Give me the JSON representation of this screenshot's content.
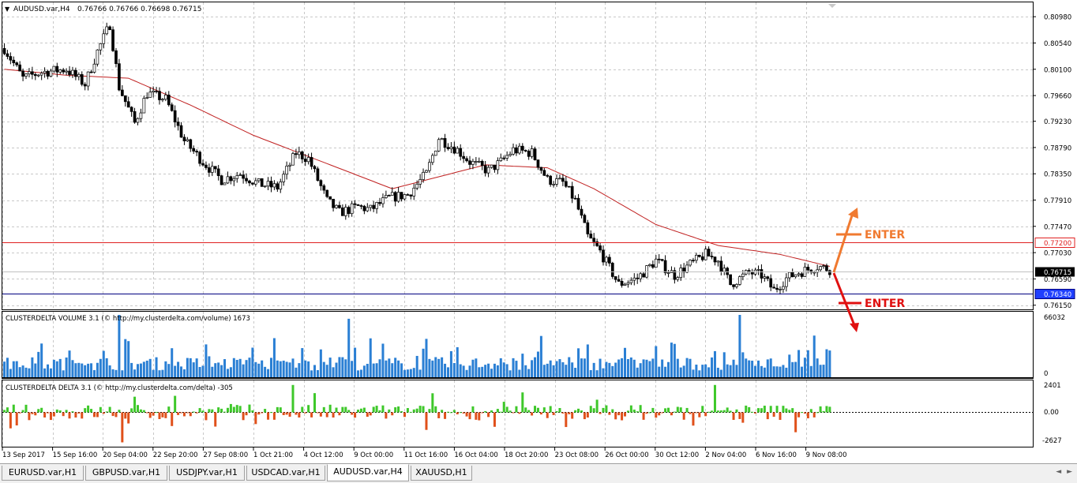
{
  "chart_header": {
    "symbol_label": "AUDUSD.var,H4",
    "ohlc": "0.76766 0.76766 0.76698 0.76715",
    "menu_arrow": "▼"
  },
  "price_axis": {
    "ticks": [
      {
        "label": "0.80980",
        "value": 0.8098
      },
      {
        "label": "0.80540",
        "value": 0.8054
      },
      {
        "label": "0.80100",
        "value": 0.801
      },
      {
        "label": "0.79660",
        "value": 0.7966
      },
      {
        "label": "0.79230",
        "value": 0.7923
      },
      {
        "label": "0.78790",
        "value": 0.7879
      },
      {
        "label": "0.78350",
        "value": 0.7835
      },
      {
        "label": "0.77910",
        "value": 0.7791
      },
      {
        "label": "0.77470",
        "value": 0.7747
      },
      {
        "label": "0.77030",
        "value": 0.7703
      },
      {
        "label": "0.76590",
        "value": 0.7659
      },
      {
        "label": "0.76150",
        "value": 0.7615
      }
    ],
    "ylim": [
      0.7608,
      0.8122
    ]
  },
  "levels": [
    {
      "label": "0.77200",
      "value": 0.772,
      "color": "#e02020",
      "label_bg": "#ffffff",
      "label_fg": "#e02020"
    },
    {
      "label": "0.76340",
      "value": 0.7634,
      "color": "#000080",
      "label_bg": "#1f3fff",
      "label_fg": "#ffffff"
    }
  ],
  "current_price": {
    "label": "0.76715",
    "value": 0.76715
  },
  "annotations": {
    "enter_up": {
      "text": "ENTER",
      "color": "#f07a30"
    },
    "enter_down": {
      "text": "ENTER",
      "color": "#e01010"
    }
  },
  "time_axis": {
    "labels": [
      "13 Sep 2017",
      "15 Sep 16:00",
      "20 Sep 04:00",
      "22 Sep 20:00",
      "27 Sep 08:00",
      "1 Oct 21:00",
      "4 Oct 12:00",
      "9 Oct 00:00",
      "11 Oct 16:00",
      "16 Oct 04:00",
      "18 Oct 20:00",
      "23 Oct 08:00",
      "26 Oct 00:00",
      "30 Oct 12:00",
      "2 Nov 04:00",
      "6 Nov 16:00",
      "9 Nov 08:00"
    ]
  },
  "volume_panel": {
    "title": "CLUSTERDELTA VOLUME 3.1 (© http://my.clusterdelta.com/volume) 1673",
    "max_label": "66032",
    "max_value": 66032,
    "zero_label": "0",
    "bar_color": "#2a7fd4"
  },
  "delta_panel": {
    "title": "CLUSTERDELTA DELTA 3.1 (© http://my.clusterdelta.com/delta) -305",
    "max_label": "2401",
    "max_value": 2401,
    "zero_label": "0.00",
    "min_label": "-2627",
    "min_value": -2627,
    "pos_color": "#3ec82a",
    "neg_color": "#e0501a"
  },
  "chart_data": {
    "type": "candlestick",
    "title": "AUDUSD.var,H4",
    "series": [
      {
        "name": "AUDUSD.var,H4",
        "anchors": [
          [
            0,
            0.8045
          ],
          [
            6,
            0.7995
          ],
          [
            12,
            0.8005
          ],
          [
            20,
            0.801
          ],
          [
            26,
            0.7985
          ],
          [
            30,
            0.804
          ],
          [
            34,
            0.8085
          ],
          [
            37,
            0.798
          ],
          [
            42,
            0.792
          ],
          [
            46,
            0.797
          ],
          [
            52,
            0.796
          ],
          [
            58,
            0.789
          ],
          [
            64,
            0.7855
          ],
          [
            70,
            0.7825
          ],
          [
            76,
            0.7835
          ],
          [
            82,
            0.7818
          ],
          [
            88,
            0.7812
          ],
          [
            94,
            0.787
          ],
          [
            98,
            0.786
          ],
          [
            104,
            0.779
          ],
          [
            108,
            0.777
          ],
          [
            114,
            0.778
          ],
          [
            118,
            0.7775
          ],
          [
            124,
            0.7795
          ],
          [
            130,
            0.78
          ],
          [
            136,
            0.7835
          ],
          [
            140,
            0.7895
          ],
          [
            146,
            0.7875
          ],
          [
            150,
            0.7855
          ],
          [
            156,
            0.784
          ],
          [
            160,
            0.7855
          ],
          [
            164,
            0.7875
          ],
          [
            170,
            0.787
          ],
          [
            175,
            0.7825
          ],
          [
            180,
            0.782
          ],
          [
            184,
            0.779
          ],
          [
            188,
            0.773
          ],
          [
            192,
            0.7705
          ],
          [
            198,
            0.765
          ],
          [
            204,
            0.766
          ],
          [
            210,
            0.769
          ],
          [
            216,
            0.7665
          ],
          [
            220,
            0.768
          ],
          [
            226,
            0.77
          ],
          [
            230,
            0.769
          ],
          [
            234,
            0.765
          ],
          [
            240,
            0.767
          ],
          [
            244,
            0.7665
          ],
          [
            248,
            0.764
          ],
          [
            252,
            0.766
          ],
          [
            256,
            0.767
          ],
          [
            262,
            0.768
          ],
          [
            266,
            0.7675
          ]
        ]
      },
      {
        "name": "MA",
        "anchors": [
          [
            0,
            0.801
          ],
          [
            20,
            0.8
          ],
          [
            40,
            0.7995
          ],
          [
            60,
            0.795
          ],
          [
            80,
            0.79
          ],
          [
            100,
            0.786
          ],
          [
            125,
            0.781
          ],
          [
            140,
            0.783
          ],
          [
            155,
            0.785
          ],
          [
            175,
            0.7845
          ],
          [
            190,
            0.781
          ],
          [
            210,
            0.775
          ],
          [
            230,
            0.7715
          ],
          [
            250,
            0.77
          ],
          [
            266,
            0.768
          ]
        ]
      }
    ],
    "candle_count": 267,
    "volume": {
      "max": 66032
    },
    "delta": {
      "max": 2401,
      "min": -2627
    }
  },
  "tabs": [
    {
      "label": "EURUSD.var,H1",
      "active": false
    },
    {
      "label": "GBPUSD.var,H1",
      "active": false
    },
    {
      "label": "USDJPY.var,H1",
      "active": false
    },
    {
      "label": "USDCAD.var,H1",
      "active": false
    },
    {
      "label": "AUDUSD.var,H4",
      "active": true
    },
    {
      "label": "XAUUSD,H1",
      "active": false
    }
  ],
  "tab_scroll": "◄ ►"
}
